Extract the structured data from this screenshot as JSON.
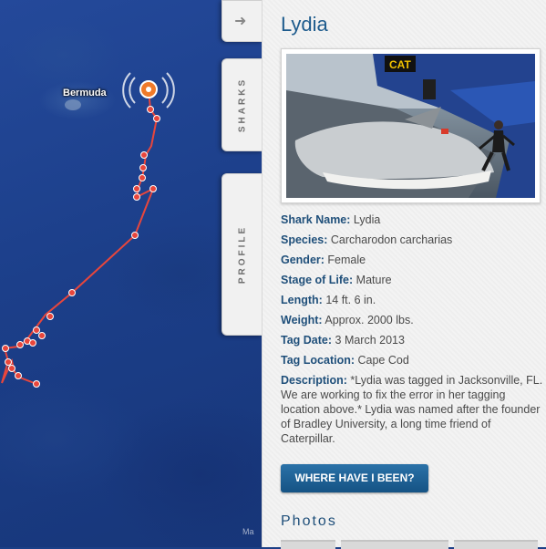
{
  "map": {
    "place_label": "Bermuda",
    "credit": "Ma"
  },
  "tabs": {
    "arrow_icon": "arrow-right-icon",
    "sharks_label": "SHARKS",
    "profile_label": "PROFILE"
  },
  "profile": {
    "title": "Lydia",
    "fields": [
      {
        "key": "Shark Name:",
        "value": "Lydia"
      },
      {
        "key": "Species:",
        "value": "Carcharodon carcharias"
      },
      {
        "key": "Gender:",
        "value": "Female"
      },
      {
        "key": "Stage of Life:",
        "value": "Mature"
      },
      {
        "key": "Length:",
        "value": "14 ft. 6 in."
      },
      {
        "key": "Weight:",
        "value": "Approx. 2000 lbs."
      },
      {
        "key": "Tag Date:",
        "value": "3 March 2013"
      },
      {
        "key": "Tag Location:",
        "value": "Cape Cod"
      }
    ],
    "description_key": "Description:",
    "description_value": "*Lydia was tagged in Jacksonville, FL. We are working to fix the error in her tagging location above.* Lydia was named after the founder of Bradley University, a long time friend of Caterpillar.",
    "photo_boat_text": "CAT",
    "button_label": "WHERE HAVE I BEEN?",
    "photos_heading": "Photos"
  },
  "colors": {
    "track": "#e8463c",
    "ping": "#f07a2a",
    "title": "#1d5b8d",
    "button": "#1b5f94"
  }
}
